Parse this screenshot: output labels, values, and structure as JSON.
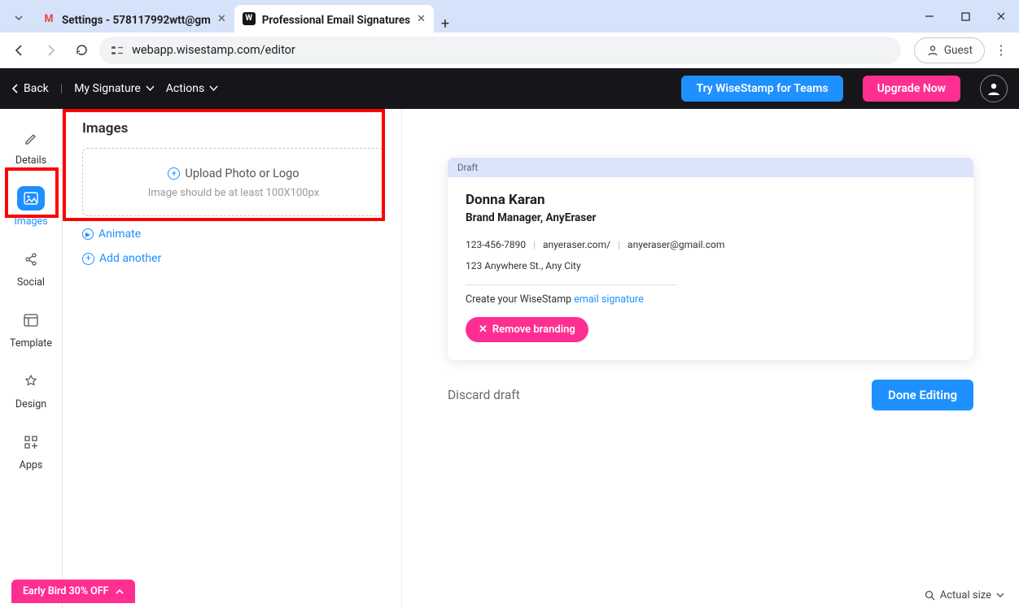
{
  "browser": {
    "tabs": [
      {
        "title": "Settings - 578117992wtt@gm",
        "favicon": "M"
      },
      {
        "title": "Professional Email Signatures",
        "favicon": "W"
      }
    ],
    "url": "webapp.wisestamp.com/editor",
    "guest_label": "Guest"
  },
  "appbar": {
    "back": "Back",
    "signature": "My Signature",
    "actions": "Actions",
    "teams_btn": "Try WiseStamp for Teams",
    "upgrade_btn": "Upgrade Now"
  },
  "rail": {
    "items": [
      {
        "label": "Details"
      },
      {
        "label": "Images"
      },
      {
        "label": "Social"
      },
      {
        "label": "Template"
      },
      {
        "label": "Design"
      },
      {
        "label": "Apps"
      }
    ]
  },
  "panel": {
    "heading": "Images",
    "upload_main": "Upload Photo or Logo",
    "upload_sub": "Image should be at least 100X100px",
    "animate": "Animate",
    "add_another": "Add another"
  },
  "preview": {
    "draft_label": "Draft",
    "name": "Donna Karan",
    "title": "Brand Manager, AnyEraser",
    "phone": "123-456-7890",
    "website": "anyeraser.com/",
    "email": "anyeraser@gmail.com",
    "address": "123 Anywhere St., Any City",
    "brand_pre": "Create your WiseStamp ",
    "brand_link": "email signature",
    "remove_btn": "Remove branding",
    "discard": "Discard draft",
    "done": "Done Editing"
  },
  "footer": {
    "offer": "Early Bird 30% OFF",
    "actual_size": "Actual size"
  }
}
